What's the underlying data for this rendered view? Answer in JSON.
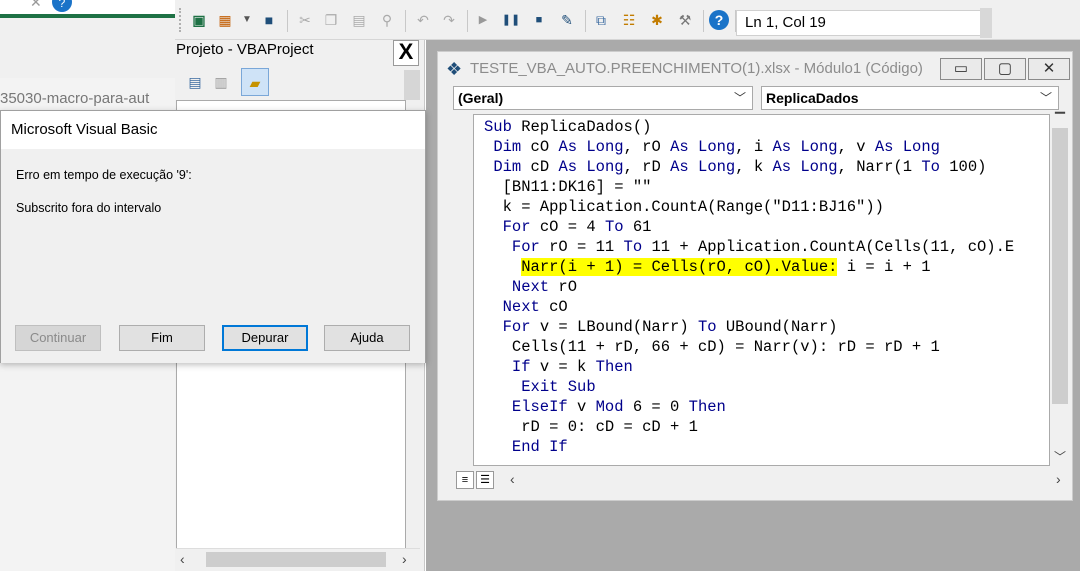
{
  "background": {
    "url_fragment": "35030-macro-para-aut"
  },
  "toolbar": {
    "cursor_position": "Ln 1, Col 19",
    "icons": [
      "excel-icon",
      "insert-userform-icon",
      "dropdown-arrow-icon",
      "save-icon",
      "cut-icon",
      "copy-icon",
      "paste-icon",
      "find-icon",
      "undo-icon",
      "redo-icon",
      "run-icon",
      "break-icon",
      "reset-icon",
      "design-mode-icon",
      "project-explorer-icon",
      "properties-icon",
      "object-browser-icon",
      "toolbox-icon",
      "help-icon"
    ]
  },
  "project_explorer": {
    "title": "Projeto - VBAProject",
    "close_label": "X"
  },
  "code_window": {
    "title": "TESTE_VBA_AUTO.PREENCHIMENTO(1).xlsx - Módulo1 (Código)",
    "object_combo": "(Geral)",
    "procedure_combo": "ReplicaDados",
    "lines": [
      "Sub ReplicaDados()",
      " Dim cO As Long, rO As Long, i As Long, v As Long",
      " Dim cD As Long, rD As Long, k As Long, Narr(1 To 100)",
      "  [BN11:DK16] = \"\"",
      "  k = Application.CountA(Range(\"D11:BJ16\"))",
      "  For cO = 4 To 61",
      "   For rO = 11 To 11 + Application.CountA(Cells(11, cO).E",
      "    Narr(i + 1) = Cells(rO, cO).Value: i = i + 1",
      "   Next rO",
      "  Next cO",
      "  For v = LBound(Narr) To UBound(Narr)",
      "   Cells(11 + rD, 66 + cD) = Narr(v): rD = rD + 1",
      "   If v = k Then",
      "    Exit Sub",
      "   ElseIf v Mod 6 = 0 Then",
      "    rD = 0: cD = cD + 1",
      "   End If"
    ],
    "highlighted_line": 7,
    "highlight_color": "#ffff00",
    "keyword_color": "#00008b"
  },
  "dialog": {
    "title": "Microsoft Visual Basic",
    "error_line": "Erro em tempo de execução '9':",
    "message": "Subscrito fora do intervalo",
    "buttons": {
      "continue": "Continuar",
      "end": "Fim",
      "debug": "Depurar",
      "help": "Ajuda"
    }
  }
}
